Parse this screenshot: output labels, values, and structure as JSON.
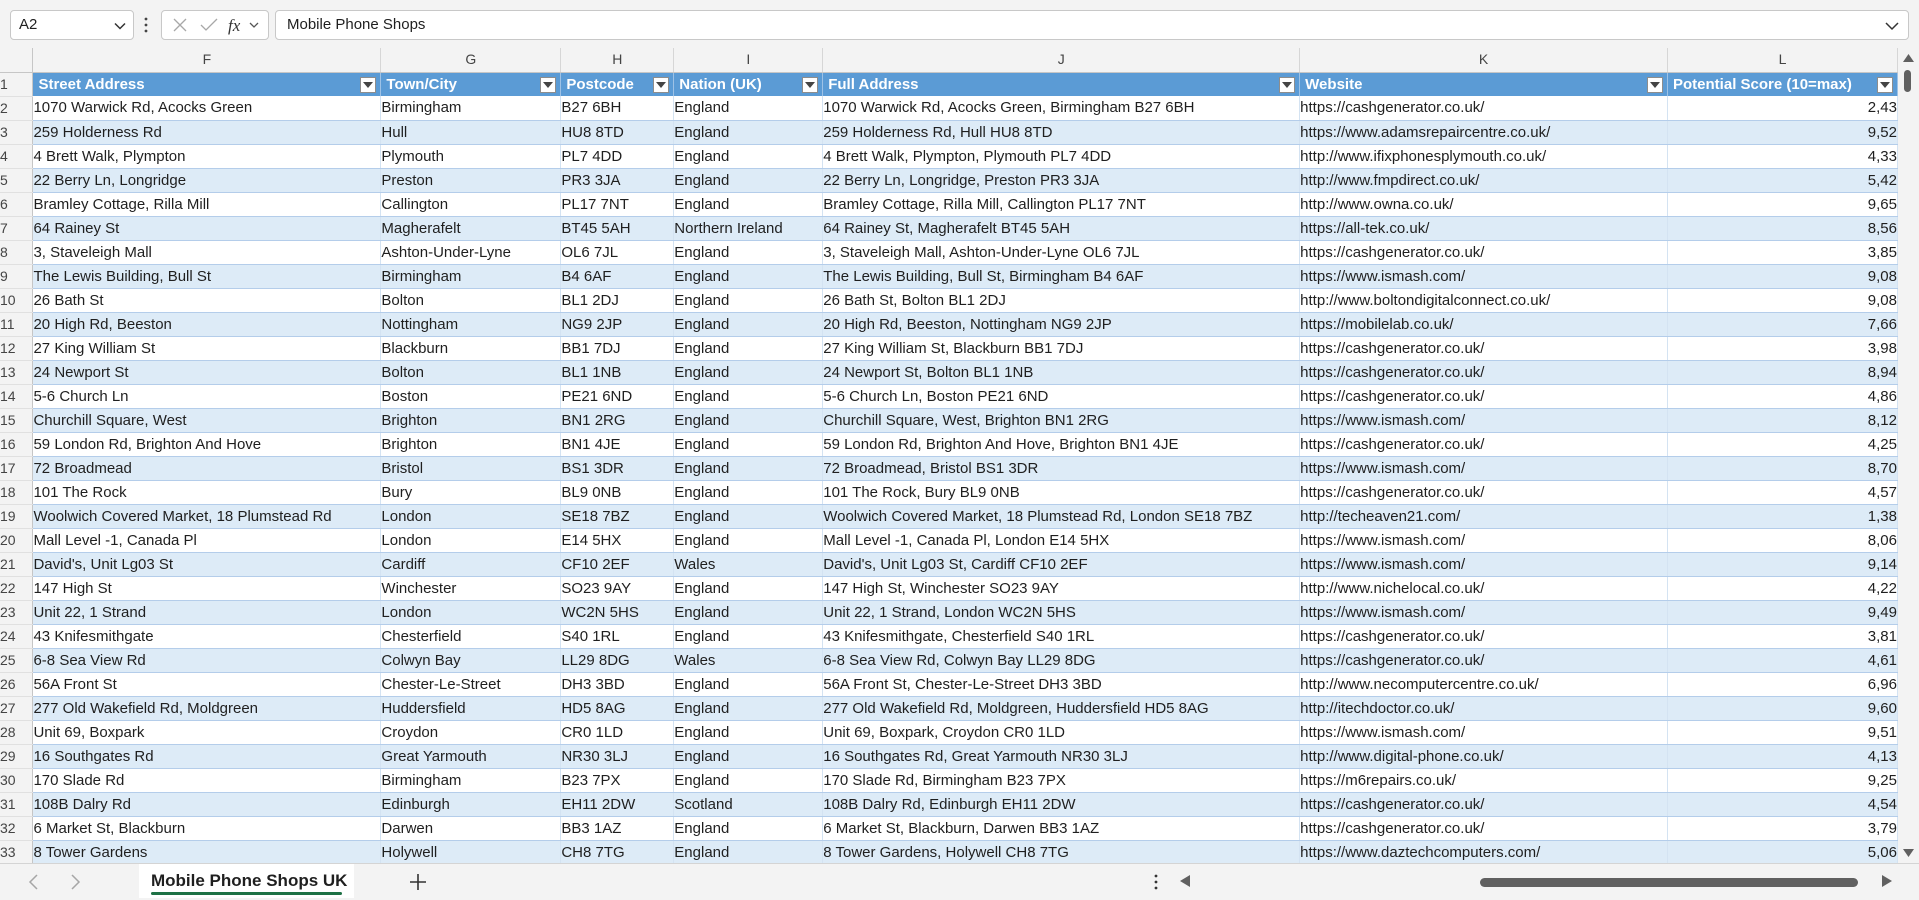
{
  "name_box": {
    "value": "A2"
  },
  "formula_bar": {
    "value": "Mobile Phone Shops"
  },
  "columns": [
    "F",
    "G",
    "H",
    "I",
    "J",
    "K",
    "L"
  ],
  "headers": [
    "Street Address",
    "Town/City",
    "Postcode",
    "Nation (UK)",
    "Full Address",
    "Website",
    "Potential Score (10=max)"
  ],
  "header_row_number": "1",
  "rows": [
    {
      "n": "2",
      "street": "1070 Warwick Rd, Acocks Green",
      "town": "Birmingham",
      "postcode": "B27 6BH",
      "nation": "England",
      "full": "1070 Warwick Rd, Acocks Green, Birmingham B27 6BH",
      "website": "https://cashgenerator.co.uk/",
      "score": "2,43"
    },
    {
      "n": "3",
      "street": "259 Holderness Rd",
      "town": "Hull",
      "postcode": "HU8 8TD",
      "nation": "England",
      "full": "259 Holderness Rd, Hull HU8 8TD",
      "website": "https://www.adamsrepaircentre.co.uk/",
      "score": "9,52"
    },
    {
      "n": "4",
      "street": "4 Brett Walk, Plympton",
      "town": "Plymouth",
      "postcode": "PL7 4DD",
      "nation": "England",
      "full": "4 Brett Walk, Plympton, Plymouth PL7 4DD",
      "website": "http://www.ifixphonesplymouth.co.uk/",
      "score": "4,33"
    },
    {
      "n": "5",
      "street": "22 Berry Ln, Longridge",
      "town": "Preston",
      "postcode": "PR3 3JA",
      "nation": "England",
      "full": "22 Berry Ln, Longridge, Preston PR3 3JA",
      "website": "http://www.fmpdirect.co.uk/",
      "score": "5,42"
    },
    {
      "n": "6",
      "street": "Bramley Cottage, Rilla Mill",
      "town": "Callington",
      "postcode": "PL17 7NT",
      "nation": "England",
      "full": "Bramley Cottage, Rilla Mill, Callington PL17 7NT",
      "website": "http://www.owna.co.uk/",
      "score": "9,65"
    },
    {
      "n": "7",
      "street": "64 Rainey St",
      "town": "Magherafelt",
      "postcode": "BT45 5AH",
      "nation": "Northern Ireland",
      "full": "64 Rainey St, Magherafelt BT45 5AH",
      "website": "https://all-tek.co.uk/",
      "score": "8,56"
    },
    {
      "n": "8",
      "street": "3, Staveleigh Mall",
      "town": "Ashton-Under-Lyne",
      "postcode": "OL6 7JL",
      "nation": "England",
      "full": "3, Staveleigh Mall, Ashton-Under-Lyne OL6 7JL",
      "website": "https://cashgenerator.co.uk/",
      "score": "3,85"
    },
    {
      "n": "9",
      "street": "The Lewis Building, Bull St",
      "town": "Birmingham",
      "postcode": "B4 6AF",
      "nation": "England",
      "full": "The Lewis Building, Bull St, Birmingham B4 6AF",
      "website": "https://www.ismash.com/",
      "score": "9,08"
    },
    {
      "n": "10",
      "street": "26 Bath St",
      "town": "Bolton",
      "postcode": "BL1 2DJ",
      "nation": "England",
      "full": "26 Bath St, Bolton BL1 2DJ",
      "website": "http://www.boltondigitalconnect.co.uk/",
      "score": "9,08"
    },
    {
      "n": "11",
      "street": "20 High Rd, Beeston",
      "town": "Nottingham",
      "postcode": "NG9 2JP",
      "nation": "England",
      "full": "20 High Rd, Beeston, Nottingham NG9 2JP",
      "website": "https://mobilelab.co.uk/",
      "score": "7,66"
    },
    {
      "n": "12",
      "street": "27 King William St",
      "town": "Blackburn",
      "postcode": "BB1 7DJ",
      "nation": "England",
      "full": "27 King William St, Blackburn BB1 7DJ",
      "website": "https://cashgenerator.co.uk/",
      "score": "3,98"
    },
    {
      "n": "13",
      "street": "24 Newport St",
      "town": "Bolton",
      "postcode": "BL1 1NB",
      "nation": "England",
      "full": "24 Newport St, Bolton BL1 1NB",
      "website": "https://cashgenerator.co.uk/",
      "score": "8,94"
    },
    {
      "n": "14",
      "street": "5-6 Church Ln",
      "town": "Boston",
      "postcode": "PE21 6ND",
      "nation": "England",
      "full": "5-6 Church Ln, Boston PE21 6ND",
      "website": "https://cashgenerator.co.uk/",
      "score": "4,86"
    },
    {
      "n": "15",
      "street": "Churchill Square, West",
      "town": "Brighton",
      "postcode": "BN1 2RG",
      "nation": "England",
      "full": "Churchill Square, West, Brighton BN1 2RG",
      "website": "https://www.ismash.com/",
      "score": "8,12"
    },
    {
      "n": "16",
      "street": "59 London Rd, Brighton And Hove",
      "town": "Brighton",
      "postcode": "BN1 4JE",
      "nation": "England",
      "full": "59 London Rd, Brighton And Hove, Brighton BN1 4JE",
      "website": "https://cashgenerator.co.uk/",
      "score": "4,25"
    },
    {
      "n": "17",
      "street": "72 Broadmead",
      "town": "Bristol",
      "postcode": "BS1 3DR",
      "nation": "England",
      "full": "72 Broadmead, Bristol BS1 3DR",
      "website": "https://www.ismash.com/",
      "score": "8,70"
    },
    {
      "n": "18",
      "street": "101 The Rock",
      "town": "Bury",
      "postcode": "BL9 0NB",
      "nation": "England",
      "full": "101 The Rock, Bury BL9 0NB",
      "website": "https://cashgenerator.co.uk/",
      "score": "4,57"
    },
    {
      "n": "19",
      "street": "Woolwich Covered Market, 18 Plumstead Rd",
      "town": "London",
      "postcode": "SE18 7BZ",
      "nation": "England",
      "full": "Woolwich Covered Market, 18 Plumstead Rd, London SE18 7BZ",
      "website": "http://techeaven21.com/",
      "score": "1,38"
    },
    {
      "n": "20",
      "street": "Mall Level -1, Canada Pl",
      "town": "London",
      "postcode": "E14 5HX",
      "nation": "England",
      "full": "Mall Level -1, Canada Pl, London E14 5HX",
      "website": "https://www.ismash.com/",
      "score": "8,06"
    },
    {
      "n": "21",
      "street": "David's, Unit Lg03 St",
      "town": "Cardiff",
      "postcode": "CF10 2EF",
      "nation": "Wales",
      "full": "David's, Unit Lg03 St, Cardiff CF10 2EF",
      "website": "https://www.ismash.com/",
      "score": "9,14"
    },
    {
      "n": "22",
      "street": "147 High St",
      "town": "Winchester",
      "postcode": "SO23 9AY",
      "nation": "England",
      "full": "147 High St, Winchester SO23 9AY",
      "website": "http://www.nichelocal.co.uk/",
      "score": "4,22"
    },
    {
      "n": "23",
      "street": "Unit 22, 1 Strand",
      "town": "London",
      "postcode": "WC2N 5HS",
      "nation": "England",
      "full": "Unit 22, 1 Strand, London WC2N 5HS",
      "website": "https://www.ismash.com/",
      "score": "9,49"
    },
    {
      "n": "24",
      "street": "43 Knifesmithgate",
      "town": "Chesterfield",
      "postcode": "S40 1RL",
      "nation": "England",
      "full": "43 Knifesmithgate, Chesterfield S40 1RL",
      "website": "https://cashgenerator.co.uk/",
      "score": "3,81"
    },
    {
      "n": "25",
      "street": "6-8 Sea View Rd",
      "town": "Colwyn Bay",
      "postcode": "LL29 8DG",
      "nation": "Wales",
      "full": "6-8 Sea View Rd, Colwyn Bay LL29 8DG",
      "website": "https://cashgenerator.co.uk/",
      "score": "4,61"
    },
    {
      "n": "26",
      "street": "56A Front St",
      "town": "Chester-Le-Street",
      "postcode": "DH3 3BD",
      "nation": "England",
      "full": "56A Front St, Chester-Le-Street DH3 3BD",
      "website": "http://www.necomputercentre.co.uk/",
      "score": "6,96"
    },
    {
      "n": "27",
      "street": "277 Old Wakefield Rd, Moldgreen",
      "town": "Huddersfield",
      "postcode": "HD5 8AG",
      "nation": "England",
      "full": "277 Old Wakefield Rd, Moldgreen, Huddersfield HD5 8AG",
      "website": "http://itechdoctor.co.uk/",
      "score": "9,60"
    },
    {
      "n": "28",
      "street": "Unit 69, Boxpark",
      "town": "Croydon",
      "postcode": "CR0 1LD",
      "nation": "England",
      "full": "Unit 69, Boxpark, Croydon CR0 1LD",
      "website": "https://www.ismash.com/",
      "score": "9,51"
    },
    {
      "n": "29",
      "street": "16 Southgates Rd",
      "town": "Great Yarmouth",
      "postcode": "NR30 3LJ",
      "nation": "England",
      "full": "16 Southgates Rd, Great Yarmouth NR30 3LJ",
      "website": "http://www.digital-phone.co.uk/",
      "score": "4,13"
    },
    {
      "n": "30",
      "street": "170 Slade Rd",
      "town": "Birmingham",
      "postcode": "B23 7PX",
      "nation": "England",
      "full": "170 Slade Rd, Birmingham B23 7PX",
      "website": "https://m6repairs.co.uk/",
      "score": "9,25"
    },
    {
      "n": "31",
      "street": "108B Dalry Rd",
      "town": "Edinburgh",
      "postcode": "EH11 2DW",
      "nation": "Scotland",
      "full": "108B Dalry Rd, Edinburgh EH11 2DW",
      "website": "https://cashgenerator.co.uk/",
      "score": "4,54"
    },
    {
      "n": "32",
      "street": "6 Market St, Blackburn",
      "town": "Darwen",
      "postcode": "BB3 1AZ",
      "nation": "England",
      "full": "6 Market St, Blackburn, Darwen BB3 1AZ",
      "website": "https://cashgenerator.co.uk/",
      "score": "3,79"
    },
    {
      "n": "33",
      "street": "8 Tower Gardens",
      "town": "Holywell",
      "postcode": "CH8 7TG",
      "nation": "England",
      "full": "8 Tower Gardens, Holywell CH8 7TG",
      "website": "https://www.daztechcomputers.com/",
      "score": "5,06"
    }
  ],
  "sheet_tab": {
    "label": "Mobile Phone Shops UK"
  },
  "colors": {
    "header_fill": "#5b9bd5",
    "band_fill": "#ddebf7",
    "tab_underline": "#1e7145"
  },
  "icons": {
    "cancel": "x-icon",
    "confirm": "check-icon",
    "function": "fx-icon"
  }
}
